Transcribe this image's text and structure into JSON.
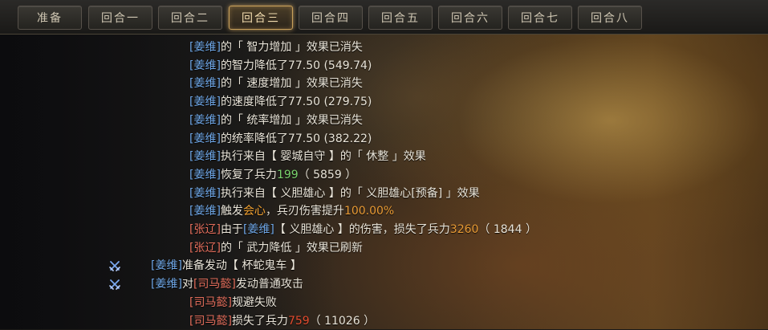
{
  "tabs": [
    {
      "label": "准备",
      "active": false
    },
    {
      "label": "回合一",
      "active": false
    },
    {
      "label": "回合二",
      "active": false
    },
    {
      "label": "回合三",
      "active": true
    },
    {
      "label": "回合四",
      "active": false
    },
    {
      "label": "回合五",
      "active": false
    },
    {
      "label": "回合六",
      "active": false
    },
    {
      "label": "回合七",
      "active": false
    },
    {
      "label": "回合八",
      "active": false
    }
  ],
  "log": [
    {
      "segments": [
        [
          "[姜维]",
          "blue"
        ],
        [
          "的「 智力增加 」效果已消失",
          ""
        ]
      ]
    },
    {
      "segments": [
        [
          "[姜维]",
          "blue"
        ],
        [
          "的智力降低了77.50 (549.74)",
          ""
        ]
      ]
    },
    {
      "segments": [
        [
          "[姜维]",
          "blue"
        ],
        [
          "的「 速度增加 」效果已消失",
          ""
        ]
      ]
    },
    {
      "segments": [
        [
          "[姜维]",
          "blue"
        ],
        [
          "的速度降低了77.50 (279.75)",
          ""
        ]
      ]
    },
    {
      "segments": [
        [
          "[姜维]",
          "blue"
        ],
        [
          "的「 统率增加 」效果已消失",
          ""
        ]
      ]
    },
    {
      "segments": [
        [
          "[姜维]",
          "blue"
        ],
        [
          "的统率降低了77.50 (382.22)",
          ""
        ]
      ]
    },
    {
      "segments": [
        [
          "[姜维]",
          "blue"
        ],
        [
          "执行来自【 婴城自守 】的「 休整 」效果",
          ""
        ]
      ]
    },
    {
      "segments": [
        [
          "[姜维]",
          "blue"
        ],
        [
          "恢复了兵力",
          ""
        ],
        [
          "199",
          "green"
        ],
        [
          "（ 5859 ）",
          ""
        ]
      ]
    },
    {
      "segments": [
        [
          "[姜维]",
          "blue"
        ],
        [
          "执行来自【 义胆雄心 】的「 义胆雄心[预备] 」效果",
          ""
        ]
      ]
    },
    {
      "segments": [
        [
          "[姜维]",
          "blue"
        ],
        [
          "触发",
          ""
        ],
        [
          "会心",
          "orange"
        ],
        [
          "，兵刃伤害提升",
          ""
        ],
        [
          "100.00%",
          "orange2"
        ]
      ]
    },
    {
      "segments": [
        [
          "[张辽]",
          "red"
        ],
        [
          "由于",
          ""
        ],
        [
          "[姜维]",
          "blue"
        ],
        [
          "【 义胆雄心 】的伤害，损失了兵力",
          ""
        ],
        [
          "3260",
          "orange2"
        ],
        [
          "（ 1844 ）",
          ""
        ]
      ]
    },
    {
      "segments": [
        [
          "[张辽]",
          "red"
        ],
        [
          "的「 武力降低 」效果已刷新",
          ""
        ]
      ]
    },
    {
      "segments": [
        [
          "[姜维]",
          "blue"
        ],
        [
          "准备发动【 杯蛇鬼车 】",
          ""
        ]
      ],
      "icon": "crossed-swords-icon"
    },
    {
      "segments": [
        [
          "[姜维]",
          "blue"
        ],
        [
          "对",
          ""
        ],
        [
          "[司马懿]",
          "red"
        ],
        [
          "发动普通攻击",
          ""
        ]
      ],
      "icon": "crossed-swords-icon"
    },
    {
      "segments": [
        [
          "[司马懿]",
          "red"
        ],
        [
          "规避失败",
          ""
        ]
      ]
    },
    {
      "segments": [
        [
          "[司马懿]",
          "red"
        ],
        [
          "损失了兵力",
          ""
        ],
        [
          "759",
          "red2"
        ],
        [
          "（ 11026 ）",
          ""
        ]
      ]
    }
  ],
  "colors": {
    "ally_name": "#6ea6e6",
    "enemy_name": "#e46e5c",
    "heal": "#79d36c",
    "crit": "#f0a030",
    "damage": "#e89a34",
    "active_tab_glow": "#c9a15b"
  }
}
